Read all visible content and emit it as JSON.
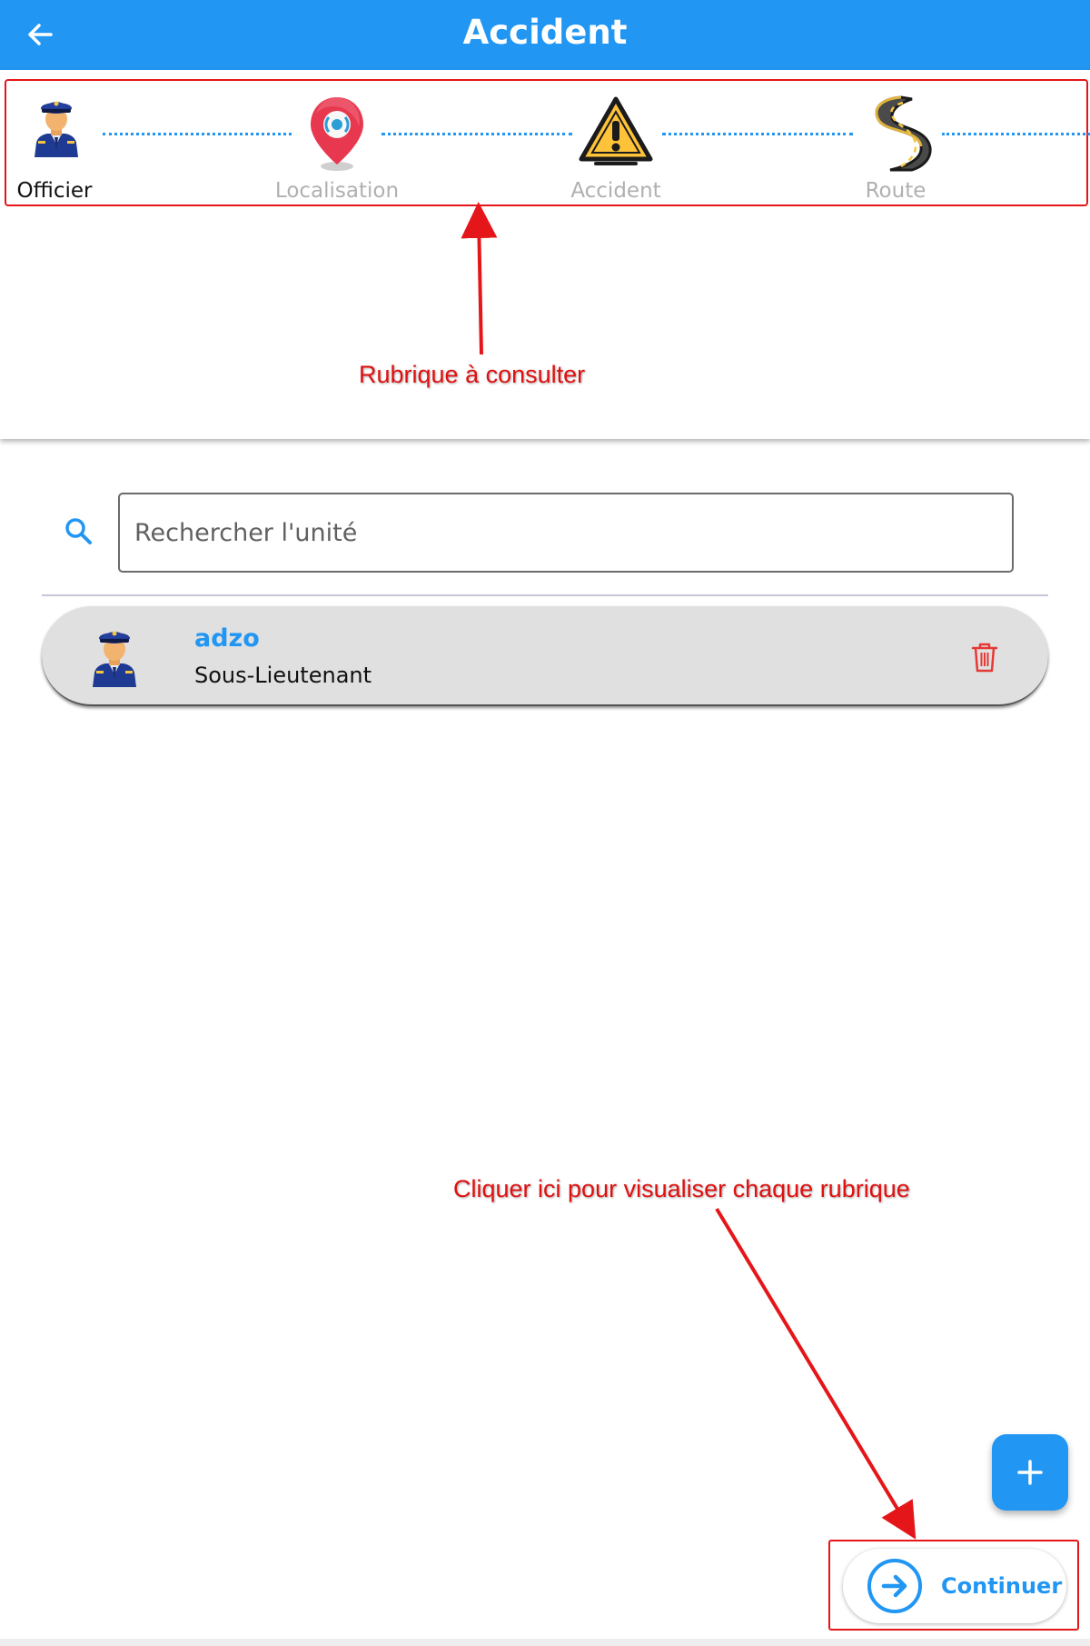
{
  "app_bar": {
    "title": "Accident",
    "back_icon": "arrow-left-icon"
  },
  "steps": [
    {
      "label": "Officier",
      "icon": "police-officer-icon",
      "state": "active"
    },
    {
      "label": "Localisation",
      "icon": "location-pin-icon",
      "state": "inactive"
    },
    {
      "label": "Accident",
      "icon": "warning-triangle-icon",
      "state": "inactive"
    },
    {
      "label": "Route",
      "icon": "road-icon",
      "state": "inactive"
    }
  ],
  "annotations": {
    "stepper_note": "Rubrique à consulter",
    "continue_note": "Cliquer ici pour visualiser chaque rubrique"
  },
  "search": {
    "placeholder": "Rechercher l'unité",
    "value": ""
  },
  "list": {
    "items": [
      {
        "name": "adzo",
        "rank": "Sous-Lieutenant",
        "avatar": "police-officer-icon",
        "action_icon": "trash-icon"
      }
    ]
  },
  "actions": {
    "add_icon": "plus-icon",
    "continue_label": "Continuer",
    "continue_icon": "arrow-right-circle-icon"
  },
  "colors": {
    "primary": "#2196F3",
    "annotation": "#e01010",
    "delete": "#e53935",
    "list_bg": "#e0e0e0"
  }
}
